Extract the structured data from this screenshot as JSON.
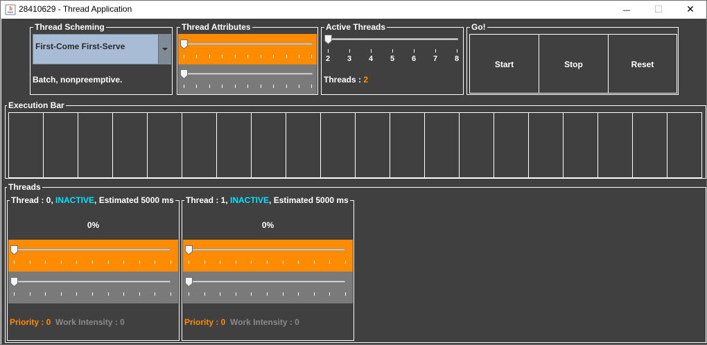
{
  "window": {
    "title": "28410629 - Thread Application",
    "controls": {
      "minimize": "—",
      "maximize": "☐",
      "close": "✕"
    }
  },
  "colors": {
    "orange": "#ff8c00",
    "background": "#404040",
    "inactive": "#00e5ff",
    "slider_gray": "#7a7a7a"
  },
  "scheming": {
    "legend": "Thread Scheming",
    "selected": "First-Come First-Serve",
    "description": "Batch, nonpreemptive."
  },
  "attributes": {
    "legend": "Thread Attributes"
  },
  "active_threads": {
    "legend": "Active Threads",
    "tick_labels": [
      "2",
      "3",
      "4",
      "5",
      "6",
      "7",
      "8"
    ],
    "count_label": "Threads : ",
    "count_value": "2",
    "slider_value": 2
  },
  "go": {
    "legend": "Go!",
    "start": "Start",
    "stop": "Stop",
    "reset": "Reset"
  },
  "execution_bar": {
    "legend": "Execution Bar",
    "cell_count": 20
  },
  "threads_panel": {
    "legend": "Threads",
    "threads": [
      {
        "legend_prefix": "Thread : 0, ",
        "status": "INACTIVE",
        "legend_suffix": ", Estimated 5000 ms",
        "progress": "0%",
        "priority_label": "Priority : 0",
        "work_label": "Work Intensity : 0"
      },
      {
        "legend_prefix": "Thread : 1, ",
        "status": "INACTIVE",
        "legend_suffix": ", Estimated 5000 ms",
        "progress": "0%",
        "priority_label": "Priority : 0",
        "work_label": "Work Intensity : 0"
      }
    ]
  }
}
